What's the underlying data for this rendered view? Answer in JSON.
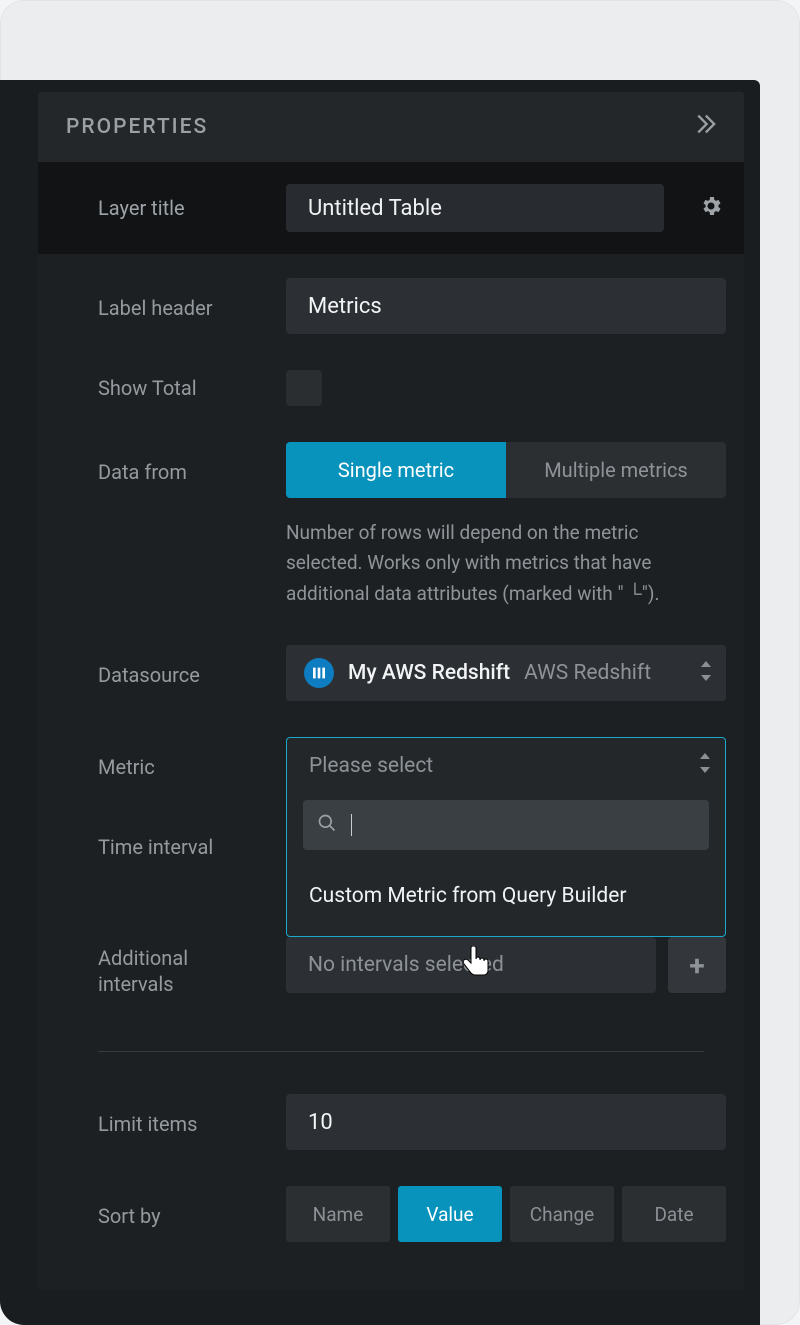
{
  "panel": {
    "title": "PROPERTIES"
  },
  "layer_title": {
    "label": "Layer title",
    "value": "Untitled Table"
  },
  "label_header": {
    "label": "Label header",
    "value": "Metrics"
  },
  "show_total": {
    "label": "Show Total"
  },
  "data_from": {
    "label": "Data from",
    "options": [
      "Single metric",
      "Multiple metrics"
    ],
    "help": "Number of rows will depend on the metric selected. Works only with metrics that have additional data attributes (marked with \" └\")."
  },
  "datasource": {
    "label": "Datasource",
    "name": "My AWS Redshift",
    "type": "AWS Redshift"
  },
  "metric": {
    "label": "Metric",
    "placeholder": "Please select",
    "search_value": "",
    "option": "Custom Metric from Query Builder"
  },
  "time_interval": {
    "label": "Time interval"
  },
  "additional_intervals": {
    "label": "Additional intervals",
    "placeholder": "No intervals selected"
  },
  "limit_items": {
    "label": "Limit items",
    "value": "10"
  },
  "sort_by": {
    "label": "Sort by",
    "options": [
      "Name",
      "Value",
      "Change",
      "Date"
    ]
  }
}
